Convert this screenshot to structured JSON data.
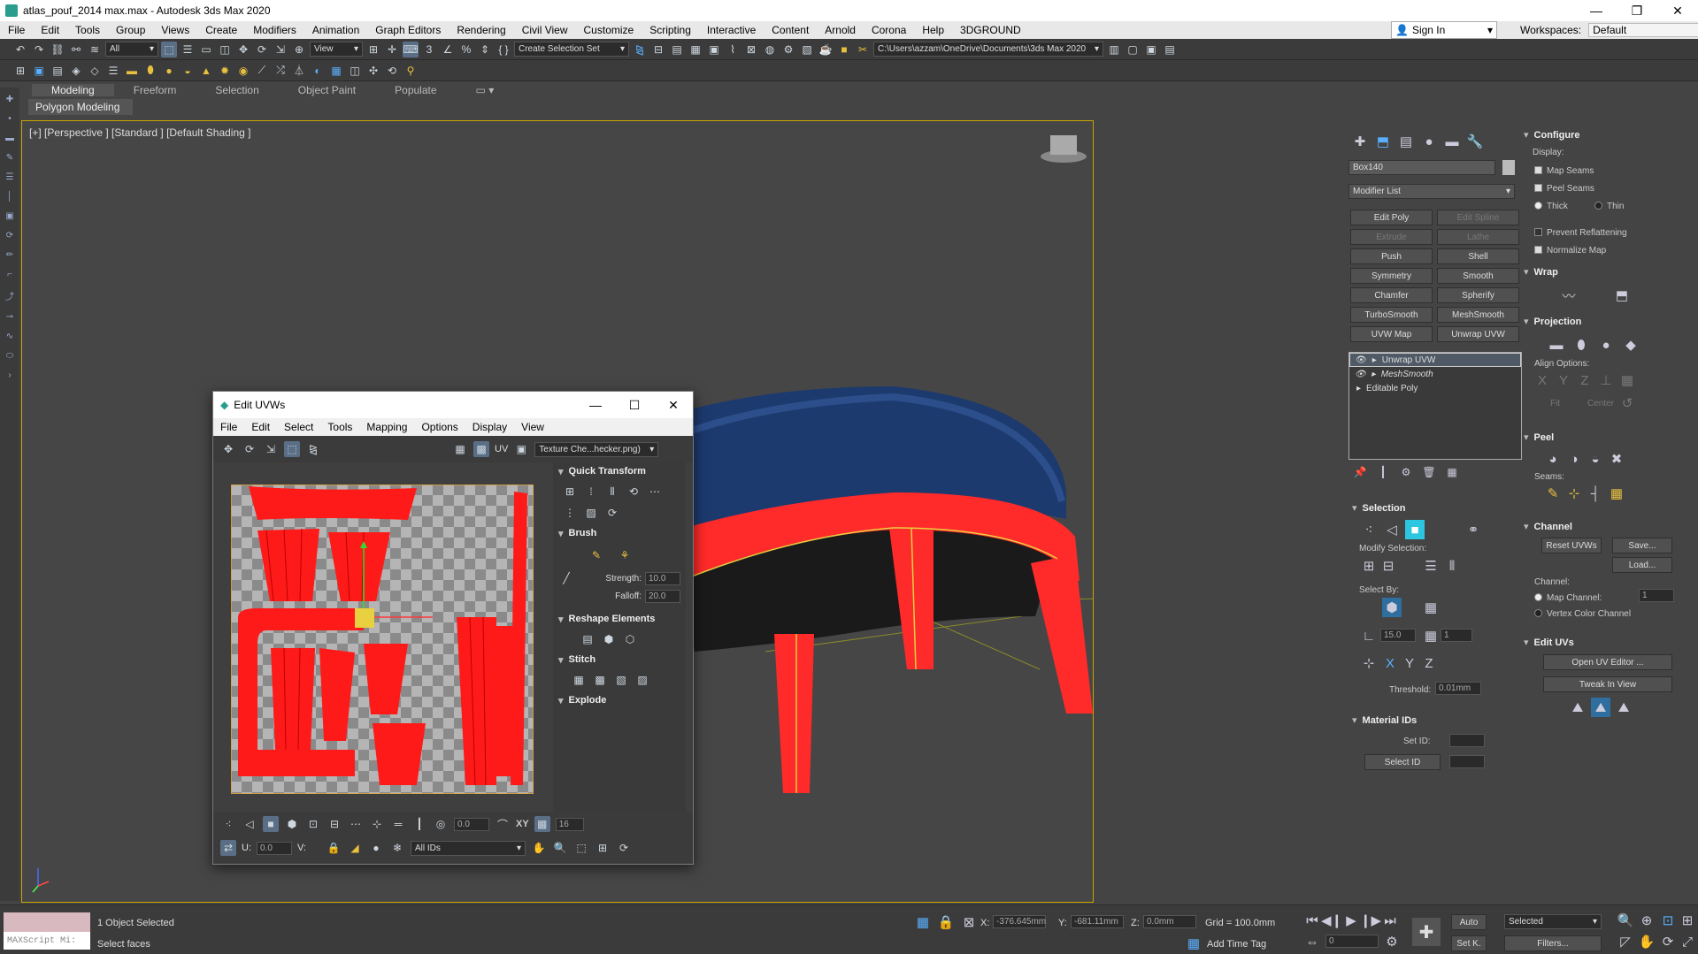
{
  "window": {
    "title": "atlas_pouf_2014 max.max - Autodesk 3ds Max 2020",
    "min": "—",
    "max": "❐",
    "close": "✕"
  },
  "menu": [
    "File",
    "Edit",
    "Tools",
    "Group",
    "Views",
    "Create",
    "Modifiers",
    "Animation",
    "Graph Editors",
    "Rendering",
    "Civil View",
    "Customize",
    "Scripting",
    "Interactive",
    "Content",
    "Arnold",
    "Corona",
    "Help",
    "3DGROUND"
  ],
  "signin": {
    "label": "Sign In"
  },
  "workspaces": {
    "label": "Workspaces:",
    "value": "Default"
  },
  "toolbar1": {
    "filter": "All",
    "refcoord": "View",
    "selection_set": "Create Selection Set",
    "path": "C:\\Users\\azzam\\OneDrive\\Documents\\3ds Max 2020"
  },
  "ribbon": {
    "tabs": [
      "Modeling",
      "Freeform",
      "Selection",
      "Object Paint",
      "Populate"
    ],
    "subtab": "Polygon Modeling"
  },
  "viewport": {
    "label": "[+] [Perspective ] [Standard ] [Default Shading ]",
    "accent": "#c9a400"
  },
  "uv_editor": {
    "title": "Edit UVWs",
    "menu": [
      "File",
      "Edit",
      "Select",
      "Tools",
      "Mapping",
      "Options",
      "Display",
      "View"
    ],
    "texture": "Texture Che...hecker.png)",
    "uv_label": "UV",
    "sections": {
      "quick_transform": "Quick Transform",
      "brush": "Brush",
      "strength_label": "Strength:",
      "strength": "10.0",
      "falloff_label": "Falloff:",
      "falloff": "20.0",
      "reshape": "Reshape Elements",
      "stitch": "Stitch",
      "explode": "Explode"
    },
    "bottom": {
      "angle": "0.0",
      "xy": "XY",
      "grid": "16",
      "u_label": "U:",
      "u": "0.0",
      "v_label": "V:",
      "ids": "All IDs"
    }
  },
  "command_panel": {
    "object_name": "Box140",
    "modifier_list": "Modifier List",
    "buttons": [
      {
        "label": "Edit Poly",
        "enabled": true
      },
      {
        "label": "Edit Spline",
        "enabled": false
      },
      {
        "label": "Extrude",
        "enabled": false
      },
      {
        "label": "Lathe",
        "enabled": false
      },
      {
        "label": "Push",
        "enabled": true
      },
      {
        "label": "Shell",
        "enabled": true
      },
      {
        "label": "Symmetry",
        "enabled": true
      },
      {
        "label": "Smooth",
        "enabled": true
      },
      {
        "label": "Chamfer",
        "enabled": true
      },
      {
        "label": "Spherify",
        "enabled": true
      },
      {
        "label": "TurboSmooth",
        "enabled": true
      },
      {
        "label": "MeshSmooth",
        "enabled": true
      },
      {
        "label": "UVW Map",
        "enabled": true
      },
      {
        "label": "Unwrap UVW",
        "enabled": true
      }
    ],
    "stack": [
      "Unwrap UVW",
      "MeshSmooth",
      "Editable Poly"
    ],
    "selection": {
      "title": "Selection",
      "modify": "Modify Selection:",
      "select_by": "Select By:",
      "angle": "15.0",
      "count": "1",
      "threshold_label": "Threshold:",
      "threshold": "0.01mm"
    },
    "material_ids": {
      "title": "Material IDs",
      "set_id": "Set ID:",
      "select_id": "Select ID"
    },
    "configure": {
      "title": "Configure",
      "display": "Display:",
      "map_seams": "Map Seams",
      "peel_seams": "Peel Seams",
      "thick": "Thick",
      "thin": "Thin",
      "prevent": "Prevent Reflattening",
      "normalize": "Normalize Map"
    },
    "wrap": "Wrap",
    "projection": {
      "title": "Projection",
      "align": "Align Options:",
      "fit": "Fit",
      "center": "Center",
      "axes": [
        "X",
        "Y",
        "Z"
      ]
    },
    "peel": {
      "title": "Peel",
      "seams": "Seams:"
    },
    "channel": {
      "title": "Channel",
      "reset": "Reset UVWs",
      "save": "Save...",
      "load": "Load...",
      "channel_label": "Channel:",
      "map_channel": "Map Channel:",
      "map_channel_value": "1",
      "vertex_color": "Vertex Color Channel"
    },
    "edit_uvs": {
      "title": "Edit UVs",
      "open": "Open UV Editor ...",
      "tweak": "Tweak In View"
    }
  },
  "status": {
    "maxscript": "MAXScript Mi:",
    "selected": "1 Object Selected",
    "prompt": "Select faces",
    "x_label": "X:",
    "x": "-376.645mm",
    "y_label": "Y:",
    "y": "-681.11mm",
    "z_label": "Z:",
    "z": "0.0mm",
    "grid": "Grid = 100.0mm",
    "add_time_tag": "Add Time Tag",
    "auto": "Auto",
    "set_k": "Set K.",
    "filter": "Selected",
    "filters": "Filters...",
    "frame": "0"
  }
}
